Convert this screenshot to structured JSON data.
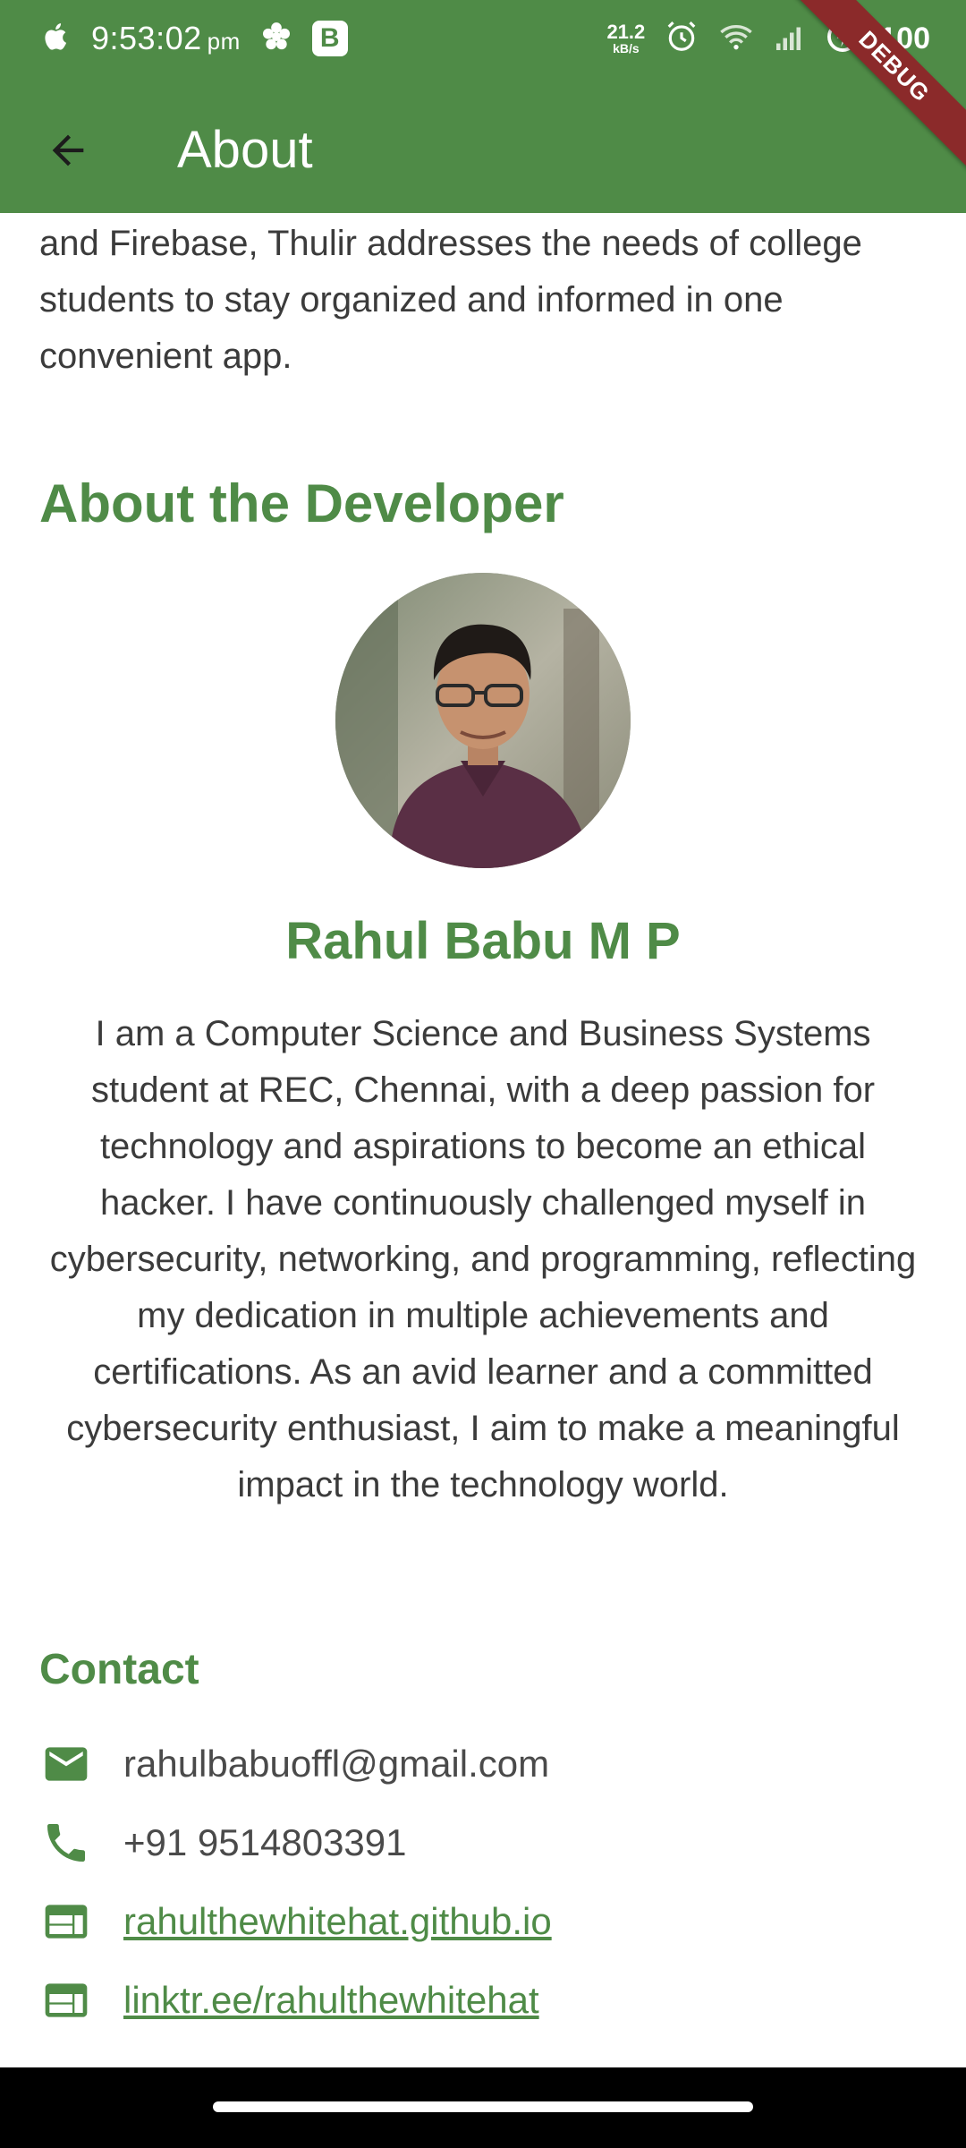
{
  "status_bar": {
    "time": "9:53:02",
    "ampm": "pm",
    "b_badge": "B",
    "net_speed_value": "21.2",
    "net_speed_unit": "kB/s",
    "battery_text": "100"
  },
  "app_bar": {
    "title": "About",
    "debug_label": "DEBUG"
  },
  "content": {
    "intro_text": "progression and other relevant details. Built with Flutter and Firebase, Thulir addresses the needs of college students to stay organized and informed in one convenient app.",
    "section_title": "About the Developer",
    "developer_name": "Rahul Babu M P",
    "bio": "I am a Computer Science and Business Systems student at REC, Chennai, with a deep passion for technology and aspirations to become an ethical hacker. I have continuously challenged myself in cybersecurity, networking, and programming, reflecting my dedication in multiple achievements and certifications. As an avid learner and a committed cybersecurity enthusiast, I aim to make a meaningful impact in the technology world."
  },
  "contact": {
    "title": "Contact",
    "email": "rahulbabuoffl@gmail.com",
    "phone": "+91 9514803391",
    "website": "rahulthewhitehat.github.io",
    "linktree": "linktr.ee/rahulthewhitehat"
  },
  "icons": {
    "email": "mail-icon",
    "phone": "phone-icon",
    "website": "web-icon",
    "linktree": "web-icon"
  },
  "colors": {
    "primary": "#4f8b47",
    "text": "#3b3b3b",
    "nav_bar": "#000000",
    "debug_ribbon": "#8b2a2a"
  }
}
